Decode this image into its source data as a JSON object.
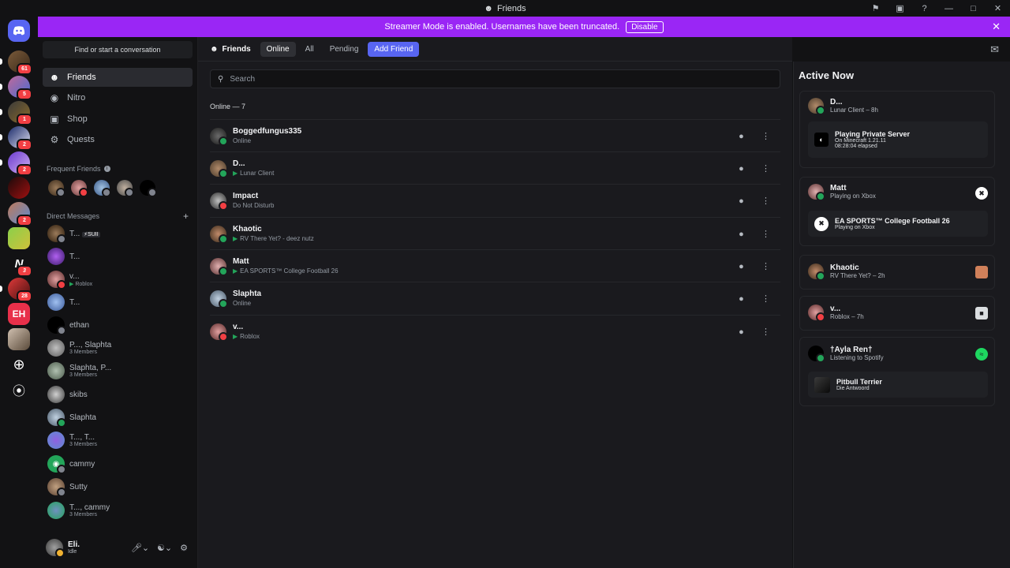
{
  "window": {
    "title": "Friends"
  },
  "banner": {
    "text": "Streamer Mode is enabled. Usernames have been truncated.",
    "button": "Disable"
  },
  "servers": {
    "badges": [
      "61",
      "5",
      "1",
      "2",
      "2",
      "2",
      "3",
      "28"
    ]
  },
  "sidebar": {
    "search_button": "Find or start a conversation",
    "nav": [
      "Friends",
      "Nitro",
      "Shop",
      "Quests"
    ],
    "frequent_friends_label": "Frequent Friends",
    "direct_messages_label": "Direct Messages",
    "dms": [
      {
        "name": "T...",
        "tag": "SUII",
        "sub": ""
      },
      {
        "name": "T...",
        "sub": ""
      },
      {
        "name": "v...",
        "sub": "Roblox"
      },
      {
        "name": "T...",
        "sub": ""
      },
      {
        "name": "ethan",
        "sub": ""
      },
      {
        "name": "P..., Slaphta",
        "sub": "3 Members"
      },
      {
        "name": "Slaphta, P...",
        "sub": "3 Members"
      },
      {
        "name": "skibs",
        "sub": ""
      },
      {
        "name": "Slaphta",
        "sub": ""
      },
      {
        "name": "T..., T...",
        "sub": "3 Members"
      },
      {
        "name": "cammy",
        "sub": ""
      },
      {
        "name": "Sutty",
        "sub": ""
      },
      {
        "name": "T..., cammy",
        "sub": "3 Members"
      }
    ],
    "user": {
      "name": "Eli.",
      "status": "Idle"
    }
  },
  "main": {
    "title": "Friends",
    "tabs": [
      "Online",
      "All",
      "Pending"
    ],
    "add_friend": "Add Friend",
    "search_placeholder": "Search",
    "online_header": "Online — 7",
    "friends": [
      {
        "name": "Boggedfungus335",
        "sub": "Online",
        "status": "online",
        "game": false
      },
      {
        "name": "D...",
        "sub": "Lunar Client",
        "status": "online",
        "game": true
      },
      {
        "name": "Impact",
        "sub": "Do Not Disturb",
        "status": "dnd",
        "game": false
      },
      {
        "name": "Khaotic",
        "sub": "RV There Yet? - deez nutz",
        "status": "online",
        "game": true
      },
      {
        "name": "Matt",
        "sub": "EA SPORTS™ College Football 26",
        "status": "online",
        "game": true
      },
      {
        "name": "Slaphta",
        "sub": "Online",
        "status": "online",
        "game": false
      },
      {
        "name": "v...",
        "sub": "Roblox",
        "status": "dnd",
        "game": true
      }
    ]
  },
  "active_now": {
    "title": "Active Now",
    "cards": [
      {
        "name": "D...",
        "sub": "Lunar Client – 8h",
        "inner_title": "Playing Private Server",
        "inner_sub1": "On Minecraft 1.21.11",
        "inner_sub2": "08:28:04 elapsed"
      },
      {
        "name": "Matt",
        "sub": "Playing on Xbox",
        "inner_title": "EA SPORTS™ College Football 26",
        "inner_sub1": "Playing on Xbox"
      },
      {
        "name": "Khaotic",
        "sub": "RV There Yet? – 2h"
      },
      {
        "name": "v...",
        "sub": "Roblox – 7h"
      },
      {
        "name": "†Ayla Ren†",
        "sub": "Listening to Spotify",
        "inner_title": "Pitbull Terrier",
        "inner_sub1": "Die Antwoord"
      }
    ]
  },
  "colors": {
    "accent": "#5865f2",
    "banner": "#9a26f5",
    "online": "#23a55a",
    "dnd": "#f23f43",
    "idle": "#f0b232"
  },
  "icons": [
    "discord-logo-icon",
    "friends-icon",
    "nitro-icon",
    "shop-icon",
    "quests-icon",
    "search-icon",
    "message-icon",
    "more-icon",
    "xbox-icon",
    "spotify-icon",
    "settings-icon",
    "mic-icon",
    "headphones-icon",
    "inbox-icon",
    "help-icon"
  ]
}
